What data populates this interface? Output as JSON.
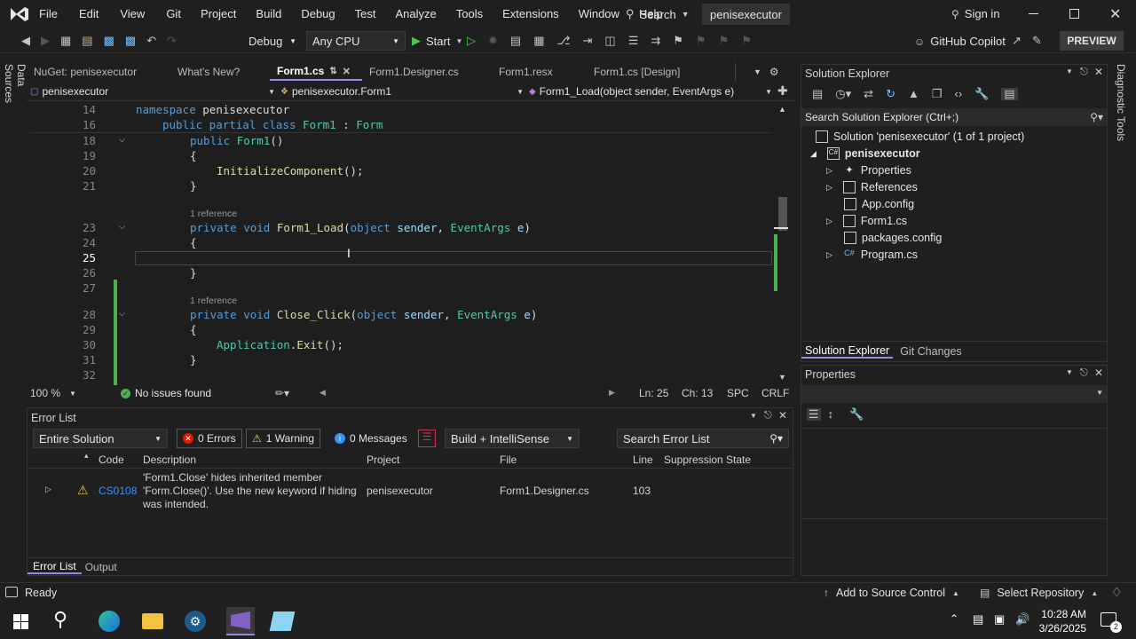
{
  "menubar": {
    "items": [
      "File",
      "Edit",
      "View",
      "Git",
      "Project",
      "Build",
      "Debug",
      "Test",
      "Analyze",
      "Tools",
      "Extensions",
      "Window",
      "Help"
    ],
    "search_label": "Search",
    "solution_name": "penisexecutor",
    "sign_in": "Sign in"
  },
  "toolbar": {
    "config": "Debug",
    "platform": "Any CPU",
    "start": "Start",
    "copilot": "GitHub Copilot",
    "preview": "PREVIEW"
  },
  "side_labels": {
    "left": "Data Sources",
    "right": "Diagnostic Tools"
  },
  "doc_tabs": [
    {
      "label": "NuGet: penisexecutor",
      "active": false
    },
    {
      "label": "What's New?",
      "active": false
    },
    {
      "label": "Form1.cs",
      "active": true
    },
    {
      "label": "Form1.Designer.cs",
      "active": false
    },
    {
      "label": "Form1.resx",
      "active": false
    },
    {
      "label": "Form1.cs [Design]",
      "active": false
    }
  ],
  "nav_bar": {
    "project": "penisexecutor",
    "class": "penisexecutor.Form1",
    "member": "Form1_Load(object sender, EventArgs e)"
  },
  "code": {
    "lines": [
      "14",
      "16",
      "18",
      "19",
      "20",
      "21",
      "23",
      "24",
      "25",
      "26",
      "27",
      "28",
      "29",
      "30",
      "31",
      "32"
    ],
    "sticky_namespace_kw": "namespace",
    "sticky_namespace_name": "penisexecutor",
    "sticky_class_kw": "public partial class",
    "sticky_class_name": "Form1",
    "sticky_colon": " : ",
    "sticky_base": "Form",
    "ctor_kw": "public ",
    "ctor_name": "Form1",
    "ctor_parens": "()",
    "brace_open": "{",
    "brace_close": "}",
    "init_call": "InitializeComponent",
    "init_tail": "();",
    "ref1": "1 reference",
    "load_kw": "private void ",
    "load_name": "Form1_Load",
    "param_kw1": "object",
    "param_sender": "sender",
    "param_type": "EventArgs",
    "param_e": "e",
    "ref2": "1 reference",
    "close_name": "Close_Click",
    "exit_class": "Application",
    "exit_call": "Exit",
    "exit_tail": "();"
  },
  "editor_status": {
    "zoom": "100 %",
    "issues": "No issues found",
    "line": "Ln: 25",
    "col": "Ch: 13",
    "spc": "SPC",
    "crlf": "CRLF"
  },
  "solution_explorer": {
    "title": "Solution Explorer",
    "search": "Search Solution Explorer (Ctrl+;)",
    "solution": "Solution 'penisexecutor' (1 of 1 project)",
    "project": "penisexecutor",
    "items": [
      "Properties",
      "References",
      "App.config",
      "Form1.cs",
      "packages.config",
      "Program.cs"
    ],
    "tab_explorer": "Solution Explorer",
    "tab_git": "Git Changes"
  },
  "properties": {
    "title": "Properties"
  },
  "error_list": {
    "title": "Error List",
    "scope": "Entire Solution",
    "errors": "0 Errors",
    "warnings": "1 Warning",
    "messages": "0 Messages",
    "build": "Build + IntelliSense",
    "search": "Search Error List",
    "columns": [
      "Code",
      "Description",
      "Project",
      "File",
      "Line",
      "Suppression State"
    ],
    "row": {
      "code": "CS0108",
      "desc1": "'Form1.Close' hides inherited member",
      "desc2": "'Form.Close()'. Use the new keyword if hiding",
      "desc3": "was intended.",
      "project": "penisexecutor",
      "file": "Form1.Designer.cs",
      "line": "103"
    },
    "tab_error": "Error List",
    "tab_output": "Output"
  },
  "statusbar": {
    "ready": "Ready",
    "source_control": "Add to Source Control",
    "repo": "Select Repository"
  },
  "taskbar": {
    "time": "10:28 AM",
    "date": "3/26/2025",
    "notif": "2"
  }
}
